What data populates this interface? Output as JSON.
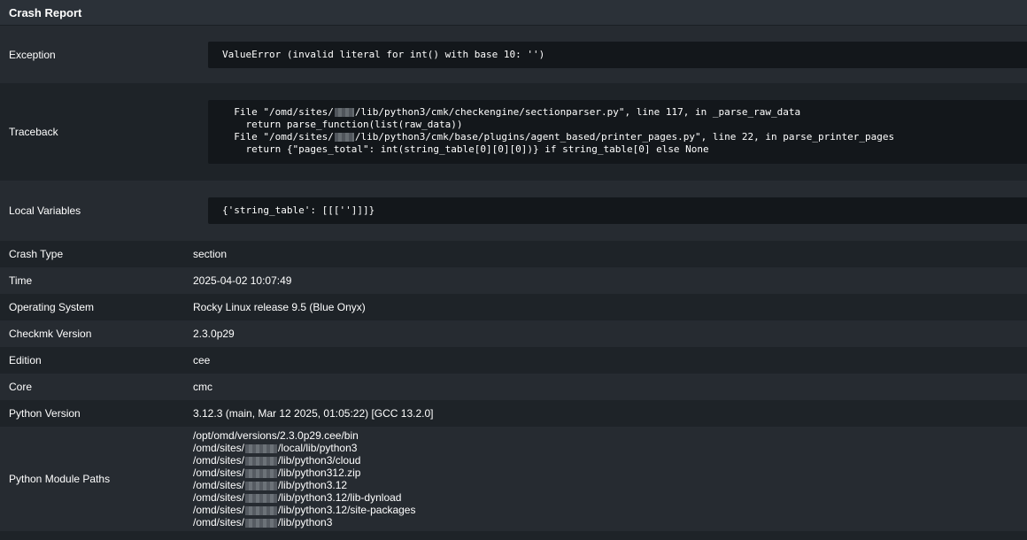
{
  "header": {
    "title": "Crash Report"
  },
  "exception": {
    "label": "Exception",
    "value": "ValueError (invalid literal for int() with base 10: '')"
  },
  "traceback": {
    "label": "Traceback",
    "lines": [
      "  File \"/omd/sites/",
      "/lib/python3/cmk/checkengine/sectionparser.py\", line 117, in _parse_raw_data",
      "    return parse_function(list(raw_data))",
      "  File \"/omd/sites/",
      "/lib/python3/cmk/base/plugins/agent_based/printer_pages.py\", line 22, in parse_printer_pages",
      "    return {\"pages_total\": int(string_table[0][0][0])} if string_table[0] else None"
    ]
  },
  "local_variables": {
    "label": "Local Variables",
    "value": "{'string_table': [[['']]]}"
  },
  "crash_type": {
    "label": "Crash Type",
    "value": "section"
  },
  "time": {
    "label": "Time",
    "value": "2025-04-02 10:07:49"
  },
  "os": {
    "label": "Operating System",
    "value": "Rocky Linux release 9.5 (Blue Onyx)"
  },
  "checkmk_version": {
    "label": "Checkmk Version",
    "value": "2.3.0p29"
  },
  "edition": {
    "label": "Edition",
    "value": "cee"
  },
  "core": {
    "label": "Core",
    "value": "cmc"
  },
  "python_version": {
    "label": "Python Version",
    "value": "3.12.3 (main, Mar 12 2025, 01:05:22) [GCC 13.2.0]"
  },
  "python_paths": {
    "label": "Python Module Paths",
    "first": "/opt/omd/versions/2.3.0p29.cee/bin",
    "prefix": "/omd/sites/",
    "suffixes": [
      "/local/lib/python3",
      "/lib/python3/cloud",
      "/lib/python312.zip",
      "/lib/python3.12",
      "/lib/python3.12/lib-dynload",
      "/lib/python3.12/site-packages",
      "/lib/python3"
    ]
  }
}
